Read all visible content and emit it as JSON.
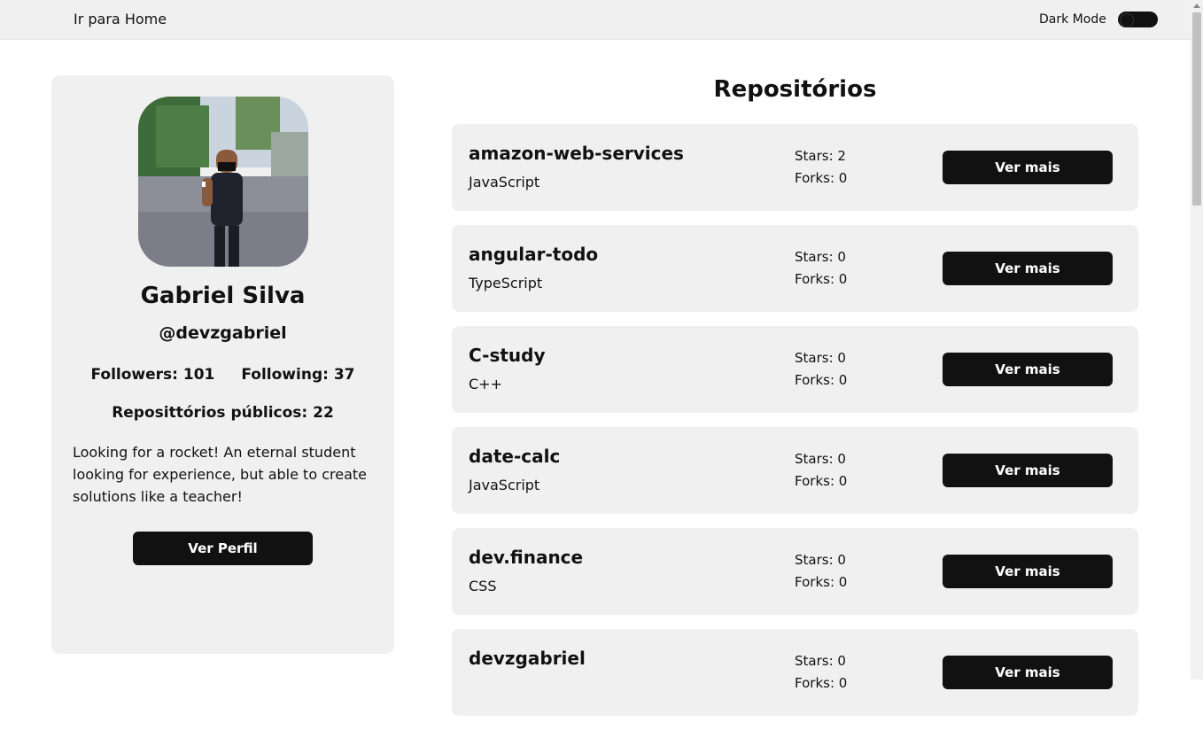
{
  "header": {
    "home_link": "Ir para Home",
    "dark_mode_label": "Dark Mode"
  },
  "profile": {
    "name": "Gabriel Silva",
    "handle": "@devzgabriel",
    "followers": "Followers: 101",
    "following": "Following: 37",
    "public_repos": "Reposittórios públicos: 22",
    "bio": "Looking for a rocket! An eternal student looking for experience, but able to create solutions like a teacher!",
    "button_label": "Ver Perfil"
  },
  "repos_title": "Repositórios",
  "repos": [
    {
      "name": "amazon-web-services",
      "language": "JavaScript",
      "stars": "Stars: 2",
      "forks": "Forks: 0",
      "button": "Ver mais"
    },
    {
      "name": "angular-todo",
      "language": "TypeScript",
      "stars": "Stars: 0",
      "forks": "Forks: 0",
      "button": "Ver mais"
    },
    {
      "name": "C-study",
      "language": "C++",
      "stars": "Stars: 0",
      "forks": "Forks: 0",
      "button": "Ver mais"
    },
    {
      "name": "date-calc",
      "language": "JavaScript",
      "stars": "Stars: 0",
      "forks": "Forks: 0",
      "button": "Ver mais"
    },
    {
      "name": "dev.finance",
      "language": "CSS",
      "stars": "Stars: 0",
      "forks": "Forks: 0",
      "button": "Ver mais"
    },
    {
      "name": "devzgabriel",
      "language": "",
      "stars": "Stars: 0",
      "forks": "Forks: 0",
      "button": "Ver mais"
    }
  ],
  "colors": {
    "background": "#ffffff",
    "card": "#f0f0f0",
    "button": "#111111",
    "text": "#111111"
  }
}
